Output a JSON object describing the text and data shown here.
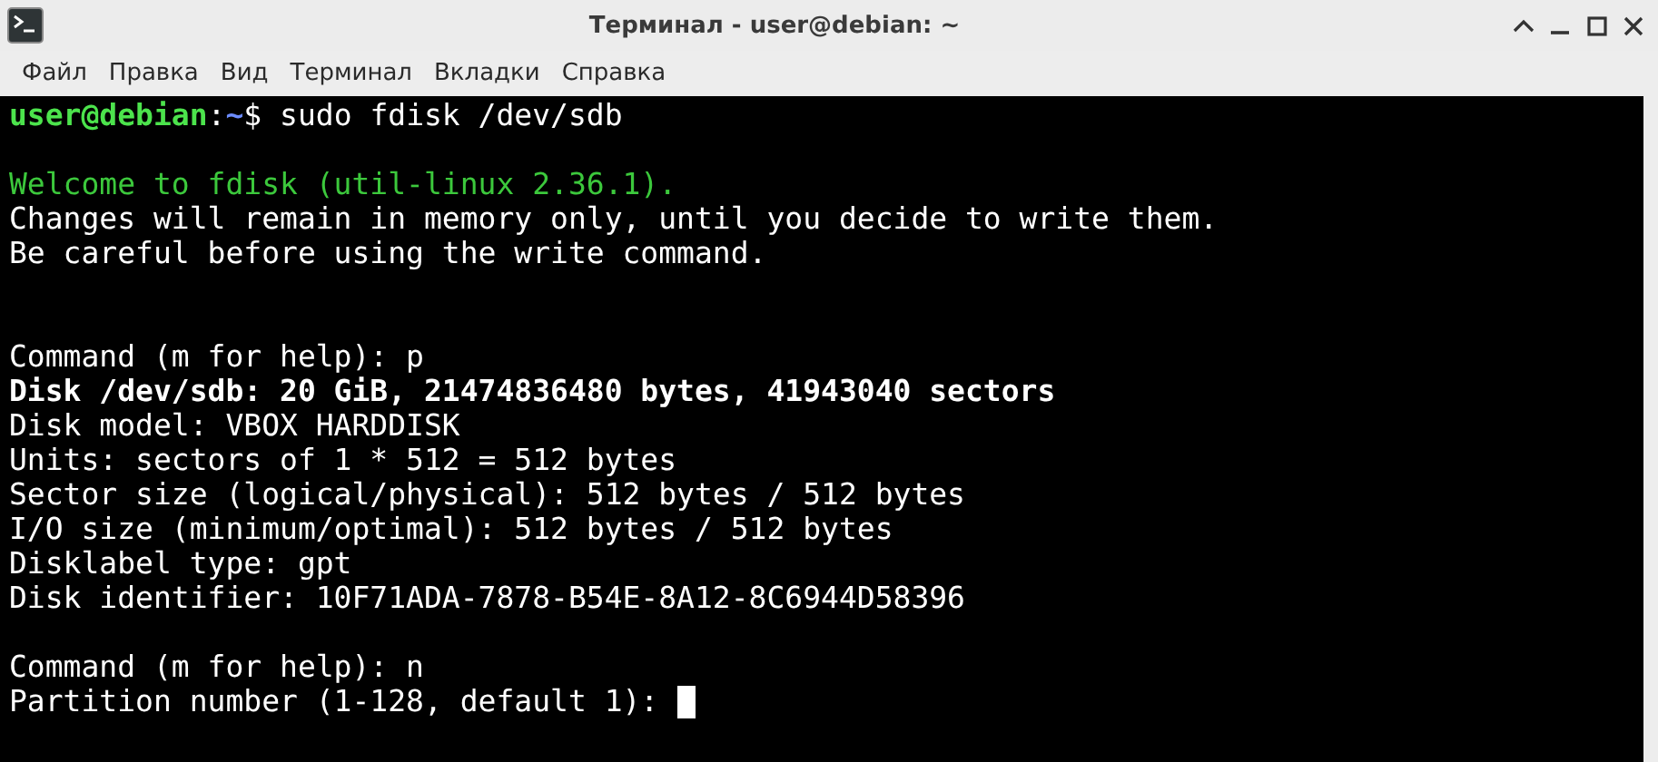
{
  "window": {
    "title": "Терминал - user@debian: ~"
  },
  "menu": [
    {
      "label": "Файл"
    },
    {
      "label": "Правка"
    },
    {
      "label": "Вид"
    },
    {
      "label": "Терминал"
    },
    {
      "label": "Вкладки"
    },
    {
      "label": "Справка"
    }
  ],
  "terminal": {
    "lines": [
      {
        "kind": "prompt",
        "user": "user@debian",
        "separator": ":",
        "path": "~",
        "symbol": "$",
        "command": "sudo fdisk /dev/sdb"
      },
      {
        "kind": "blank"
      },
      {
        "kind": "green",
        "text": "Welcome to fdisk (util-linux 2.36.1)."
      },
      {
        "kind": "plain",
        "text": "Changes will remain in memory only, until you decide to write them."
      },
      {
        "kind": "plain",
        "text": "Be careful before using the write command."
      },
      {
        "kind": "blank"
      },
      {
        "kind": "blank"
      },
      {
        "kind": "plain",
        "text": "Command (m for help): p"
      },
      {
        "kind": "bold",
        "text": "Disk /dev/sdb: 20 GiB, 21474836480 bytes, 41943040 sectors"
      },
      {
        "kind": "plain",
        "text": "Disk model: VBOX HARDDISK"
      },
      {
        "kind": "plain",
        "text": "Units: sectors of 1 * 512 = 512 bytes"
      },
      {
        "kind": "plain",
        "text": "Sector size (logical/physical): 512 bytes / 512 bytes"
      },
      {
        "kind": "plain",
        "text": "I/O size (minimum/optimal): 512 bytes / 512 bytes"
      },
      {
        "kind": "plain",
        "text": "Disklabel type: gpt"
      },
      {
        "kind": "plain",
        "text": "Disk identifier: 10F71ADA-7878-B54E-8A12-8C6944D58396"
      },
      {
        "kind": "blank"
      },
      {
        "kind": "plain",
        "text": "Command (m for help): n"
      },
      {
        "kind": "plain",
        "text": "Partition number (1-128, default 1): ",
        "cursor": true
      }
    ]
  }
}
